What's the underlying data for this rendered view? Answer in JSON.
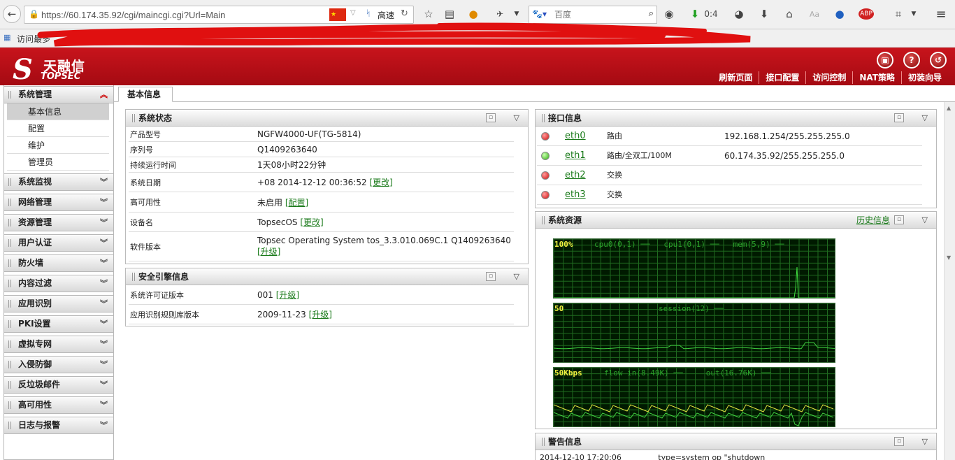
{
  "browser": {
    "url": "https://60.174.35.92/cgi/maincgi.cgi?Url=Main",
    "speed_label": "高速",
    "search_placeholder": "百度",
    "download_count": "0:4",
    "bookmark_label": "访问最多"
  },
  "header": {
    "logo_cn": "天融信",
    "logo_en": "TOPSEC",
    "nav": [
      "刷新页面",
      "接口配置",
      "访问控制",
      "NAT策略",
      "初装向导"
    ]
  },
  "sidebar": {
    "expanded": {
      "label": "系统管理",
      "children": [
        "基本信息",
        "配置",
        "维护",
        "管理员"
      ],
      "active": "基本信息"
    },
    "items": [
      "系统监视",
      "网络管理",
      "资源管理",
      "用户认证",
      "防火墙",
      "内容过滤",
      "应用识别",
      "PKI设置",
      "虚拟专网",
      "入侵防御",
      "反垃圾邮件",
      "高可用性",
      "日志与报警"
    ]
  },
  "tab": "基本信息",
  "system_status": {
    "title": "系统状态",
    "rows": [
      {
        "key": "产品型号",
        "value": "NGFW4000-UF(TG-5814)",
        "link": ""
      },
      {
        "key": "序列号",
        "value": "Q1409263640",
        "link": ""
      },
      {
        "key": "持续运行时间",
        "value": "1天08小时22分钟",
        "link": ""
      },
      {
        "key": "系统日期",
        "value": "+08 2014-12-12 00:36:52 ",
        "link": "[更改]"
      },
      {
        "key": "高可用性",
        "value": "未启用 ",
        "link": "[配置]"
      },
      {
        "key": "设备名",
        "value": "TopsecOS ",
        "link": "[更改]"
      },
      {
        "key": "软件版本",
        "value": "Topsec Operating System tos_3.3.010.069C.1 Q1409263640",
        "link": "[升级]"
      }
    ]
  },
  "security_engine": {
    "title": "安全引擎信息",
    "rows": [
      {
        "key": "系统许可证版本",
        "value": "001 ",
        "link": "[升级]"
      },
      {
        "key": "应用识别规则库版本",
        "value": "2009-11-23 ",
        "link": "[升级]"
      }
    ]
  },
  "interfaces": {
    "title": "接口信息",
    "rows": [
      {
        "name": "eth0",
        "type": "路由",
        "ip": "192.168.1.254/255.255.255.0",
        "status": "down"
      },
      {
        "name": "eth1",
        "type": "路由/全双工/100M",
        "ip": "60.174.35.92/255.255.255.0",
        "status": "up"
      },
      {
        "name": "eth2",
        "type": "交换",
        "ip": "",
        "status": "down"
      },
      {
        "name": "eth3",
        "type": "交换",
        "ip": "",
        "status": "down"
      }
    ]
  },
  "resources": {
    "title": "系统资源",
    "history_link": "历史信息",
    "graphs": [
      {
        "max": "100%",
        "legend": "cpu0(0,1) ──   cpu1(0,1) ──   mem(5,9) ──"
      },
      {
        "max": "50",
        "legend": "session(12) ──"
      },
      {
        "max": "50Kbps",
        "legend": "flow in(8.49K) ──     out(16.76K) ──"
      }
    ]
  },
  "alerts": {
    "title": "警告信息",
    "first_line": "2014-12-10 17:20:06               type=system op \"shutdown"
  },
  "colors": {
    "brand_red": "#b5101a",
    "link_green": "#1a7a1a",
    "graph_green": "#2aa02a"
  }
}
